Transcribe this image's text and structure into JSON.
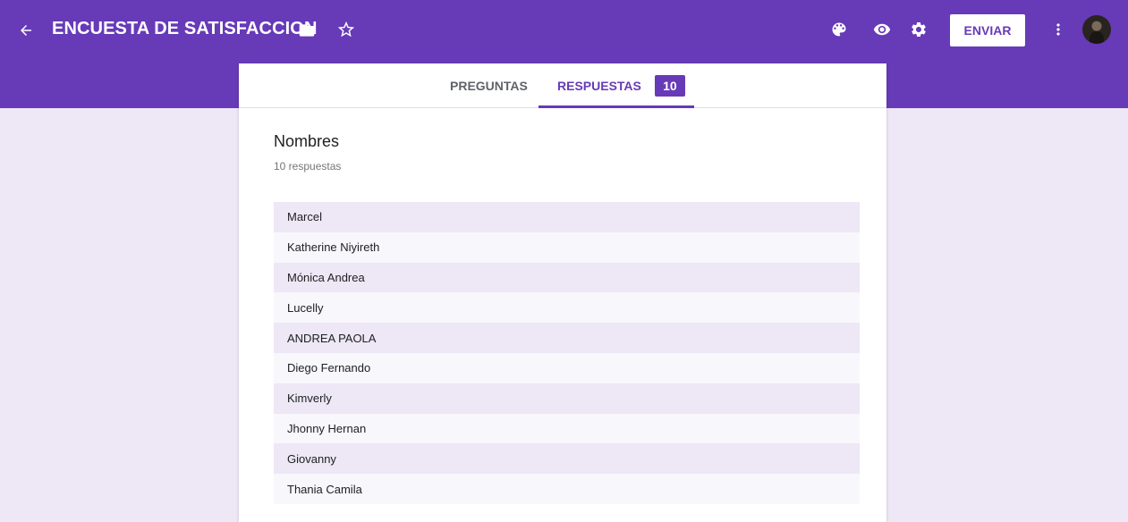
{
  "header": {
    "title": "ENCUESTA DE SATISFACCION",
    "send_label": "ENVIAR",
    "icons": [
      "back-arrow-icon",
      "folder-icon",
      "star-icon",
      "palette-icon",
      "eye-icon",
      "gear-icon",
      "more-vert-icon"
    ]
  },
  "tabs": {
    "preguntas": "PREGUNTAS",
    "respuestas": "RESPUESTAS",
    "response_badge": "10"
  },
  "question": {
    "title": "Nombres",
    "count_label": "10 respuestas",
    "answers": [
      "Marcel",
      "Katherine Niyireth",
      "Mónica Andrea",
      "Lucelly",
      "ANDREA PAOLA",
      "Diego Fernando",
      "Kimverly",
      "Jhonny Hernan",
      "Giovanny",
      "Thania Camila"
    ]
  },
  "colors": {
    "accent": "#673ab7",
    "background": "#ede7f6"
  }
}
